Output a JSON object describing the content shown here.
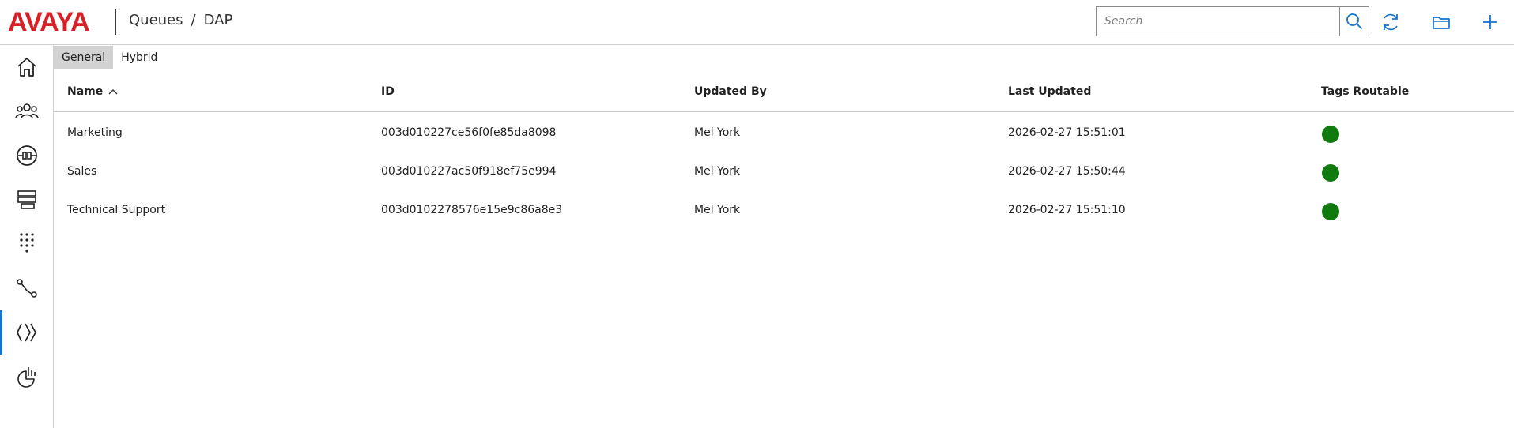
{
  "brand": {
    "logo_text": "AVAYA",
    "logo_color": "#d92027"
  },
  "breadcrumb": {
    "section": "Queues",
    "separator": "/",
    "current": "DAP"
  },
  "search": {
    "placeholder": "Search",
    "value": ""
  },
  "header_icons": [
    "search-icon",
    "refresh-icon",
    "folder-icon",
    "plus-icon"
  ],
  "sidebar": {
    "items": [
      {
        "name": "home-icon",
        "active": false
      },
      {
        "name": "users-icon",
        "active": false
      },
      {
        "name": "plug-icon",
        "active": false
      },
      {
        "name": "queues-stack-icon",
        "active": false
      },
      {
        "name": "dialpad-icon",
        "active": false
      },
      {
        "name": "routing-icon",
        "active": false
      },
      {
        "name": "chevrons-icon",
        "active": true
      },
      {
        "name": "analytics-icon",
        "active": false
      }
    ],
    "active_color": "#1473c9"
  },
  "tabs": [
    {
      "label": "General",
      "active": true
    },
    {
      "label": "Hybrid",
      "active": false
    }
  ],
  "table": {
    "columns": [
      {
        "label": "Name",
        "sorted": "ascending"
      },
      {
        "label": "ID"
      },
      {
        "label": "Updated By"
      },
      {
        "label": "Last Updated"
      },
      {
        "label": "Tags Routable"
      }
    ],
    "rows": [
      {
        "name": "Marketing",
        "id": "003d010227ce56f0fe85da8098",
        "updated_by": "Mel York",
        "last_updated": "2026-02-27 15:51:01",
        "tags_routable": true
      },
      {
        "name": "Sales",
        "id": "003d010227ac50f918ef75e994",
        "updated_by": "Mel York",
        "last_updated": "2026-02-27 15:50:44",
        "tags_routable": true
      },
      {
        "name": "Technical Support",
        "id": "003d0102278576e15e9c86a8e3",
        "updated_by": "Mel York",
        "last_updated": "2026-02-27 15:51:10",
        "tags_routable": true
      }
    ],
    "status_color": "#0f7b0f"
  }
}
